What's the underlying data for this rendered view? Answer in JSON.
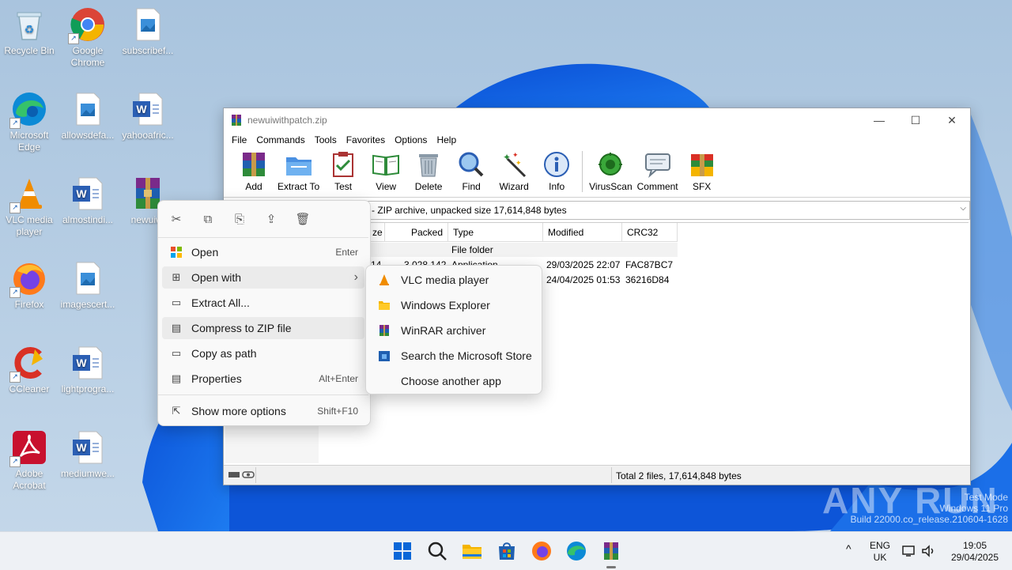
{
  "desktop": {
    "icons": [
      {
        "label": "Recycle Bin"
      },
      {
        "label": "Google Chrome"
      },
      {
        "label": "subscribef..."
      },
      {
        "label": "Microsoft Edge"
      },
      {
        "label": "allowsdefa..."
      },
      {
        "label": "yahooafric..."
      },
      {
        "label": "VLC media player"
      },
      {
        "label": "almostindi..."
      },
      {
        "label": "newuiwi"
      },
      {
        "label": "Firefox"
      },
      {
        "label": "imagescert..."
      },
      {
        "label": "CCleaner"
      },
      {
        "label": "lightprogra..."
      },
      {
        "label": "Adobe Acrobat"
      },
      {
        "label": "mediumwe..."
      }
    ]
  },
  "winrar": {
    "title": "newuiwithpatch.zip",
    "window_controls": {
      "minimize": "—",
      "maximize": "☐",
      "close": "✕"
    },
    "menu": [
      "File",
      "Commands",
      "Tools",
      "Favorites",
      "Options",
      "Help"
    ],
    "toolbar": [
      {
        "label": "Add",
        "icon": "add-icon"
      },
      {
        "label": "Extract To",
        "icon": "extract-to-icon"
      },
      {
        "label": "Test",
        "icon": "test-icon"
      },
      {
        "label": "View",
        "icon": "view-icon"
      },
      {
        "label": "Delete",
        "icon": "delete-icon"
      },
      {
        "label": "Find",
        "icon": "find-icon"
      },
      {
        "label": "Wizard",
        "icon": "wizard-icon"
      },
      {
        "label": "Info",
        "icon": "info-icon"
      },
      {
        "label": "VirusScan",
        "icon": "virusscan-icon"
      },
      {
        "label": "Comment",
        "icon": "comment-icon"
      },
      {
        "label": "SFX",
        "icon": "sfx-icon"
      }
    ],
    "path": "- ZIP archive, unpacked size 17,614,848 bytes",
    "columns": [
      "ze",
      "Packed",
      "Type",
      "Modified",
      "CRC32"
    ],
    "rows": [
      {
        "size": "",
        "packed": "",
        "type": "File folder",
        "modified": "",
        "crc": ""
      },
      {
        "size": "14",
        "packed": "3,028,142",
        "type": "Application",
        "modified": "29/03/2025 22:07",
        "crc": "FAC87BC7"
      },
      {
        "size": "",
        "packed": "",
        "type": "",
        "modified": "24/04/2025 01:53",
        "crc": "36216D84"
      }
    ],
    "status": "Total 2 files, 17,614,848 bytes"
  },
  "context_menu": {
    "quick_actions": [
      "cut-icon",
      "copy-icon",
      "rename-icon",
      "share-icon",
      "delete-icon"
    ],
    "items": [
      {
        "label": "Open",
        "shortcut": "Enter"
      },
      {
        "label": "Open with",
        "shortcut": "›"
      },
      {
        "label": "Extract All...",
        "shortcut": ""
      },
      {
        "label": "Compress to ZIP file",
        "shortcut": ""
      },
      {
        "label": "Copy as path",
        "shortcut": ""
      },
      {
        "label": "Properties",
        "shortcut": "Alt+Enter"
      },
      {
        "label": "Show more options",
        "shortcut": "Shift+F10"
      }
    ]
  },
  "open_with": {
    "items": [
      "VLC media player",
      "Windows Explorer",
      "WinRAR archiver",
      "Search the Microsoft Store",
      "Choose another app"
    ]
  },
  "taskbar": {
    "lang_top": "ENG",
    "lang_bottom": "UK",
    "time": "19:05",
    "date": "29/04/2025",
    "chevron": "^"
  },
  "watermark": {
    "brand": "ANY RUN",
    "line1": "Test Mode",
    "line2": "Windows 11 Pro",
    "line3": "Build 22000.co_release.210604-1628"
  }
}
